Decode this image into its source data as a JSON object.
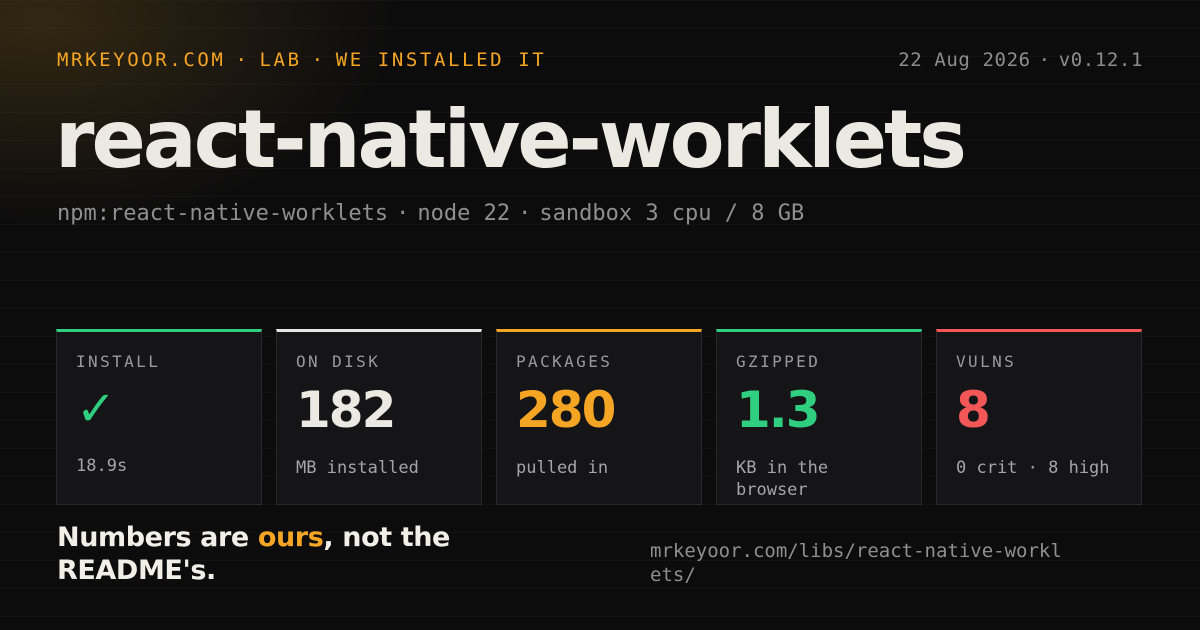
{
  "header": {
    "kicker": [
      "MRKEYOOR.COM",
      "LAB",
      "WE INSTALLED IT"
    ],
    "date": "22 Aug 2026",
    "version": "v0.12.1"
  },
  "title": "react-native-worklets",
  "subtitle": [
    "npm:react-native-worklets",
    "node 22",
    "sandbox 3 cpu / 8 GB"
  ],
  "separator": "·",
  "stats": [
    {
      "label": "INSTALL",
      "value": "✓",
      "sub": "18.9s",
      "color": "#2fcf7f",
      "bar": "#2fcf7f"
    },
    {
      "label": "ON DISK",
      "value": "182",
      "sub": "MB installed",
      "color": "#ece9e2",
      "bar": "#e6e6e6"
    },
    {
      "label": "PACKAGES",
      "value": "280",
      "sub": "pulled in",
      "color": "#f5a524",
      "bar": "#f5a524"
    },
    {
      "label": "GZIPPED",
      "value": "1.3",
      "sub": "KB in the browser",
      "color": "#2fcf7f",
      "bar": "#2fcf7f"
    },
    {
      "label": "VULNS",
      "value": "8",
      "sub": "0 crit · 8 high",
      "color": "#f25757",
      "bar": "#f25757"
    }
  ],
  "footer": {
    "tagline_pre": "Numbers are ",
    "tagline_accent": "ours",
    "tagline_post": ", not the README's.",
    "url": "mrkeyoor.com/libs/react-native-worklets/"
  },
  "colors": {
    "accent": "#f5a524",
    "background": "#0c0c0d"
  }
}
